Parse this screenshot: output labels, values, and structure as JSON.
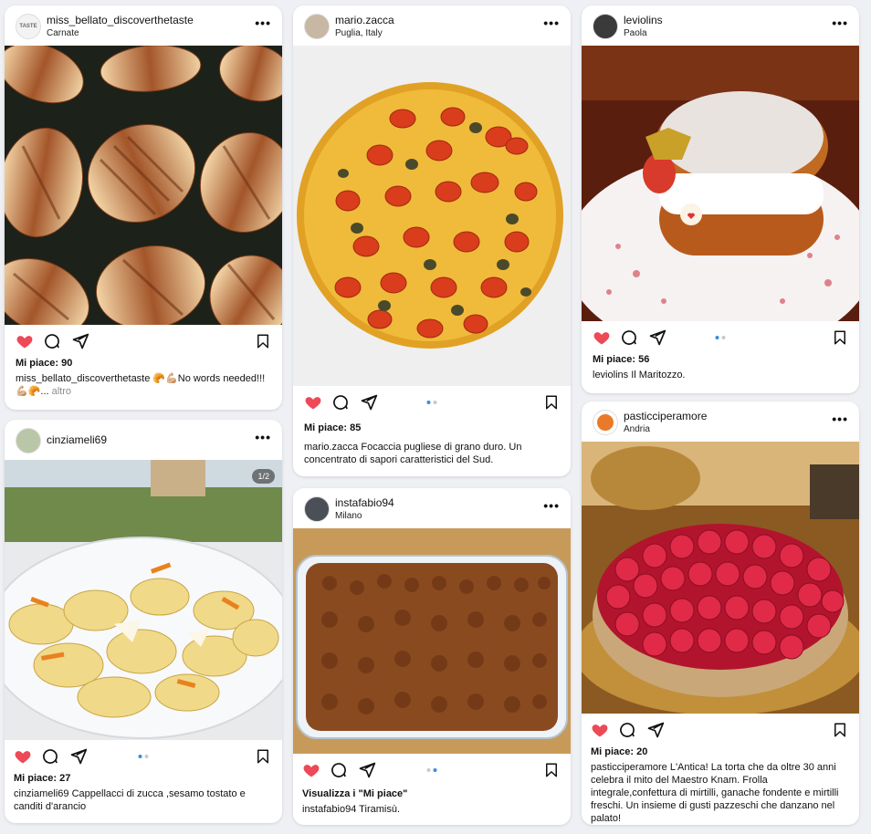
{
  "posts": [
    {
      "username": "miss_bellato_discoverthetaste",
      "location": "Carnate",
      "avatar_text": "TASTE",
      "likes": "Mi piace: 90",
      "caption_user": "miss_bellato_discoverthetaste",
      "caption_text": " 🥐💪🏼No words needed!!! 💪🏼🥐...",
      "more_label": "altro"
    },
    {
      "username": "mario.zacca",
      "location": "Puglia, Italy",
      "likes": "Mi piace: 85",
      "caption_user": "mario.zacca",
      "caption_text": " Focaccia pugliese di grano duro. Un concentrato di sapori caratteristici del Sud."
    },
    {
      "username": "leviolins",
      "location": "Paola",
      "likes": "Mi piace: 56",
      "caption_user": "leviolins",
      "caption_text": " Il Maritozzo."
    },
    {
      "username": "cinziameli69",
      "image_counter": "1/2",
      "likes": "Mi piace: 27",
      "caption_user": "cinziameli69",
      "caption_text": " Cappellacci di zucca ,sesamo tostato e canditi d'arancio"
    },
    {
      "username": "instafabio94",
      "location": "Milano",
      "likes": "Visualizza i \"Mi piace\"",
      "caption_user": "instafabio94",
      "caption_text": " Tiramisù."
    },
    {
      "username": "pasticciperamore",
      "location": "Andria",
      "likes": "Mi piace: 20",
      "caption_user": "pasticciperamore",
      "caption_text": " L'Antica! La torta che da oltre 30 anni celebra il mito del Maestro Knam. Frolla integrale,confettura di mirtilli, ganache fondente e mirtilli freschi. Un insieme di gusti pazzeschi  che danzano nel palato!"
    }
  ],
  "ui": {
    "more_dots": "•••",
    "like_color": "#ed4956",
    "dot_active_color": "#3a8de0"
  }
}
